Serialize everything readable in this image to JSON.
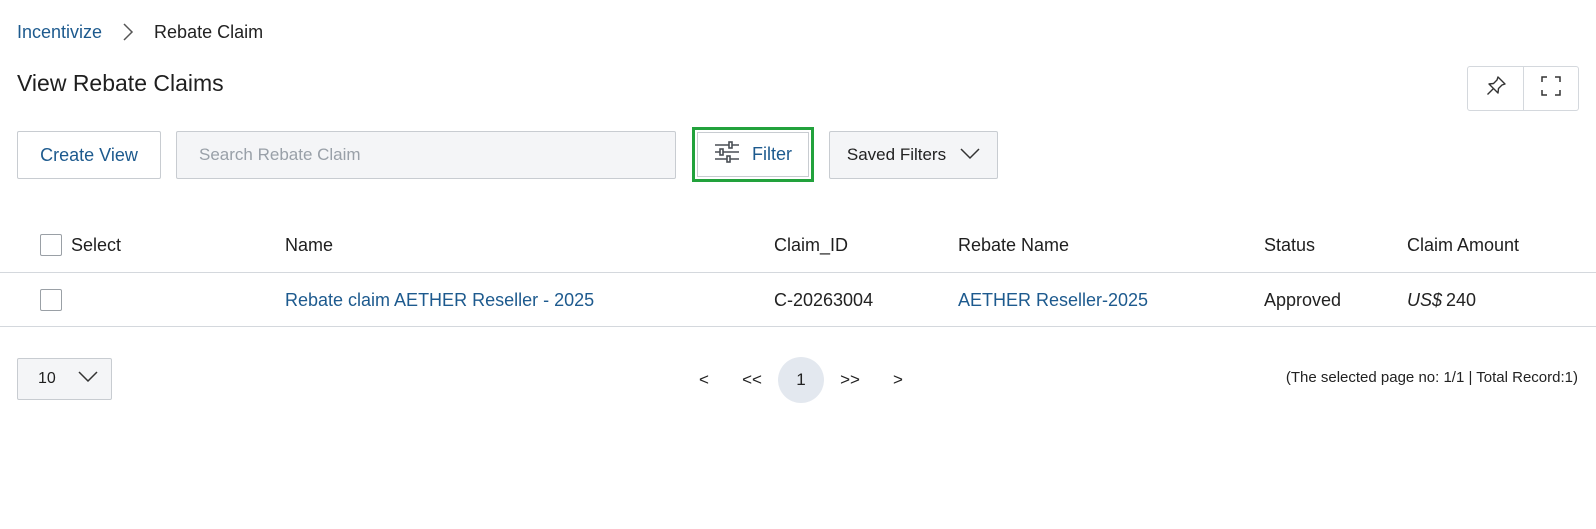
{
  "breadcrumb": {
    "root": "Incentivize",
    "current": "Rebate Claim"
  },
  "page": {
    "title": "View Rebate Claims"
  },
  "toolbar": {
    "create_view_label": "Create View",
    "search_placeholder": "Search Rebate Claim",
    "filter_label": "Filter",
    "saved_filters_label": "Saved Filters",
    "highlight_color": "#22a23c"
  },
  "table": {
    "columns": [
      "Select",
      "Name",
      "Claim_ID",
      "Rebate Name",
      "Status",
      "Claim Amount"
    ],
    "rows": [
      {
        "name": "Rebate claim AETHER Reseller - 2025",
        "claim_id": "C-20263004",
        "rebate_name": "AETHER Reseller-2025",
        "status": "Approved",
        "currency": "US$",
        "amount": "240"
      }
    ]
  },
  "pagination": {
    "page_size": "10",
    "prev": "<",
    "first": "<<",
    "current": "1",
    "last": ">>",
    "next": ">",
    "info": "(The selected page no: 1/1 | Total Record:1)"
  },
  "colors": {
    "link": "#1d5a8e",
    "border": "#c8ccd1",
    "input_bg": "#f4f5f7"
  }
}
